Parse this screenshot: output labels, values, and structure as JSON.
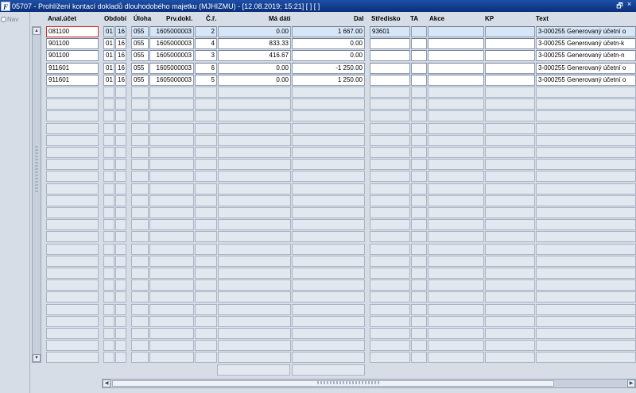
{
  "window": {
    "title": "05707 - Prohlížení kontací dokladů dlouhodobého majetku (MJHIZMU) - [12.08.2019; 15:21]  [ ]  [ ]",
    "app_icon_label": "F",
    "restore_glyph": "🗗",
    "close_glyph": "×"
  },
  "nav": {
    "label": "Nav"
  },
  "scrollbar": {
    "up": "▲",
    "down": "▼",
    "left": "◀",
    "right": "▶"
  },
  "columns": {
    "anal_ucet": "Anal.účet",
    "obdobi": "Období",
    "uloha": "Úloha",
    "prv_dokl": "Prv.dokl.",
    "cr": "Č.ř.",
    "ma_dati": "Má dáti",
    "dal": "Dal",
    "stredisko": "Středisko",
    "ta": "TA",
    "akce": "Akce",
    "kp": "KP",
    "text": "Text"
  },
  "rows": [
    {
      "anal_ucet": "081100",
      "obdobi_m": "01",
      "obdobi_y": "16",
      "uloha": "055",
      "prv_dokl": "1605000003",
      "cr": "2",
      "ma_dati": "0.00",
      "dal": "1 667.00",
      "stredisko": "93601",
      "ta": "",
      "akce": "",
      "kp": "",
      "text": "3-000255 Generovaný účetní o"
    },
    {
      "anal_ucet": "901100",
      "obdobi_m": "01",
      "obdobi_y": "16",
      "uloha": "055",
      "prv_dokl": "1605000003",
      "cr": "4",
      "ma_dati": "833.33",
      "dal": "0.00",
      "stredisko": "",
      "ta": "",
      "akce": "",
      "kp": "",
      "text": "3-000255 Generovaný účetn-k"
    },
    {
      "anal_ucet": "901100",
      "obdobi_m": "01",
      "obdobi_y": "16",
      "uloha": "055",
      "prv_dokl": "1605000003",
      "cr": "3",
      "ma_dati": "416.67",
      "dal": "0.00",
      "stredisko": "",
      "ta": "",
      "akce": "",
      "kp": "",
      "text": "3-000255 Generovaný účetn-n"
    },
    {
      "anal_ucet": "911601",
      "obdobi_m": "01",
      "obdobi_y": "16",
      "uloha": "055",
      "prv_dokl": "1605000003",
      "cr": "6",
      "ma_dati": "0.00",
      "dal": "-1 250.00",
      "stredisko": "",
      "ta": "",
      "akce": "",
      "kp": "",
      "text": "3-000255 Generovaný účetní o"
    },
    {
      "anal_ucet": "911601",
      "obdobi_m": "01",
      "obdobi_y": "16",
      "uloha": "055",
      "prv_dokl": "1605000003",
      "cr": "5",
      "ma_dati": "0.00",
      "dal": "1 250.00",
      "stredisko": "",
      "ta": "",
      "akce": "",
      "kp": "",
      "text": "3-000255 Generovaný účetní o"
    }
  ],
  "colors": {
    "title_bar": "#0a2f7a",
    "active_row": "#d7e6f6",
    "focus_border": "#d32f2f"
  }
}
